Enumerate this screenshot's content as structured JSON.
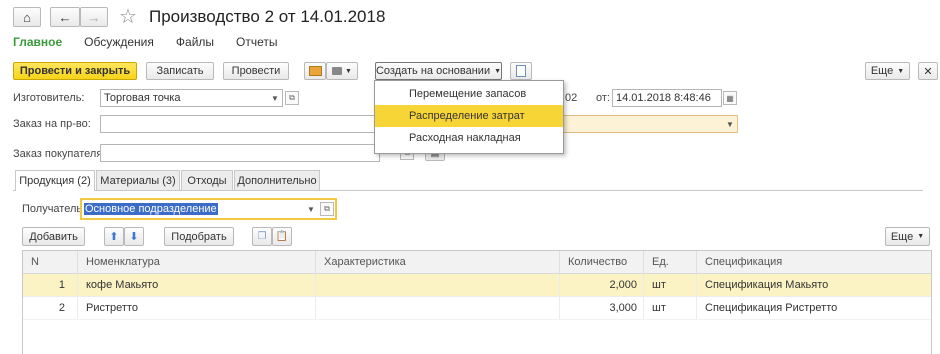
{
  "window": {
    "title": "Производство 2 от 14.01.2018"
  },
  "nav": {
    "home": "⌂",
    "back": "←",
    "forward": "→",
    "star": "☆"
  },
  "menu": {
    "tabs": [
      "Главное",
      "Обсуждения",
      "Файлы",
      "Отчеты"
    ],
    "active_color": "#3a9b3a"
  },
  "toolbar": {
    "post_close": "Провести и закрыть",
    "save": "Записать",
    "post": "Провести",
    "create_basis": "Создать на основании",
    "more": "Еще"
  },
  "dropdown": {
    "items": [
      "Перемещение запасов",
      "Распределение затрат",
      "Расходная накладная"
    ],
    "highlight_index": 1,
    "highlight_color": "#f8d537"
  },
  "form": {
    "manufacturer_label": "Изготовитель:",
    "manufacturer_value": "Торговая точка",
    "number_tail": "02",
    "from_label": "от:",
    "date_value": "14.01.2018  8:48:46",
    "order_label": "Заказ на пр-во:",
    "order_value": "",
    "customer_order_label": "Заказ покупателя:",
    "customer_order_value": ""
  },
  "tabs": [
    "Продукция (2)",
    "Материалы (3)",
    "Отходы",
    "Дополнительно"
  ],
  "recipient": {
    "label": "Получатель:",
    "value": "Основное подразделение"
  },
  "table_toolbar": {
    "add": "Добавить",
    "pick": "Подобрать",
    "more": "Еще"
  },
  "table": {
    "columns": [
      "N",
      "Номенклатура",
      "Характеристика",
      "Количество",
      "Ед.",
      "Спецификация"
    ],
    "rows": [
      {
        "n": "1",
        "item": "кофе Макьято",
        "char": "",
        "qty": "2,000",
        "unit": "шт",
        "spec": "Спецификация Макьято"
      },
      {
        "n": "2",
        "item": "Ристретто",
        "char": "",
        "qty": "3,000",
        "unit": "шт",
        "spec": "Спецификация Ристретто"
      }
    ],
    "selected_row_color": "#fbf3c4"
  }
}
